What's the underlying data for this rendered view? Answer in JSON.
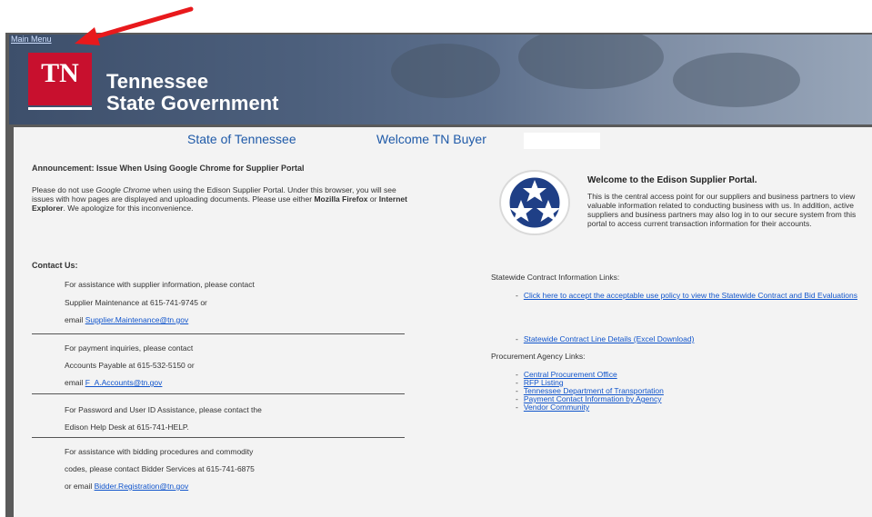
{
  "nav": {
    "main_menu": "Main Menu"
  },
  "brand": {
    "logo_abbrev": "TN",
    "line1": "Tennessee",
    "line2": "State Government"
  },
  "header": {
    "state": "State of Tennessee",
    "welcome": "Welcome  TN Buyer"
  },
  "announcement": {
    "title": "Announcement: Issue When Using Google Chrome for Supplier Portal",
    "p1": "Please do not use ",
    "p1_italic": "Google Chrome",
    "p1b": " when using the Edison Supplier Portal. Under this browser, you will see issues with how pages are displayed and uploading documents. Please use either ",
    "firefox": "Mozilla Firefox",
    "or": " or ",
    "ie": "Internet Explorer",
    "p1c": ".  We apologize for this inconvenience."
  },
  "contact": {
    "title": "Contact Us:",
    "supplier_1": "For assistance with supplier information, please contact",
    "supplier_2": "Supplier Maintenance at 615-741-9745 or",
    "supplier_3": "email ",
    "supplier_email": "Supplier.Maintenance@tn.gov",
    "payment_1": "For payment inquiries, please contact",
    "payment_2": "Accounts Payable at 615-532-5150 or",
    "payment_3": "email ",
    "payment_email": "F_A.Accounts@tn.gov",
    "password_1": "For Password and User ID Assistance, please contact the",
    "password_2": "Edison Help Desk at  615-741-HELP.",
    "bid_1": "For assistance with bidding procedures and commodity",
    "bid_2": "codes, please contact Bidder Services at 615-741-6875",
    "bid_3": "or email ",
    "bid_email": "Bidder.Registration@tn.gov"
  },
  "welcome": {
    "title": "Welcome to the Edison Supplier Portal.",
    "body": "This is the central access point for our suppliers and business partners to view valuable information related to conducting business with us. In addition, active suppliers and business partners may also log in to our secure system from this portal to access current transaction information for their accounts."
  },
  "statewide": {
    "title": "Statewide Contract Information Links:",
    "link1": "Click here to accept the acceptable use policy to view the Statewide Contract and Bid Evaluations",
    "link2": "Statewide Contract Line Details  (Excel Download)"
  },
  "procurement": {
    "title": "Procurement Agency Links:",
    "links": [
      "Central Procurement Office",
      "RFP Listing",
      "Tennessee Department of Transportation",
      "Payment Contact Information by Agency",
      "Vendor Community"
    ]
  },
  "bullet": "-",
  "colors": {
    "accent": "#1f5aa8",
    "logo_red": "#c8102e",
    "link": "#1155cc",
    "arrow": "#e8191c"
  }
}
